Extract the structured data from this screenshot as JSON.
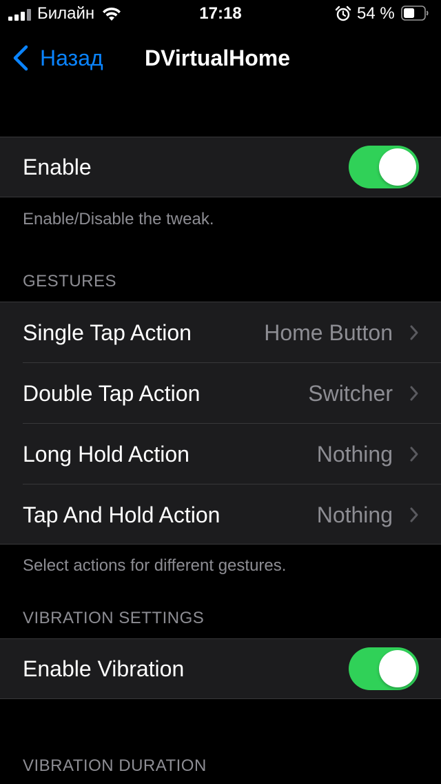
{
  "status_bar": {
    "carrier": "Билайн",
    "time": "17:18",
    "battery_percent": "54 %",
    "battery_level": 0.54,
    "signal_bars_filled": 3,
    "signal_bars_total": 4,
    "icons": [
      "signal-icon",
      "wifi-icon",
      "alarm-icon",
      "battery-icon"
    ]
  },
  "nav": {
    "back_label": "Назад",
    "title": "DVirtualHome",
    "accent_color": "#0a84ff"
  },
  "enable_section": {
    "row_label": "Enable",
    "toggle_on": true,
    "footer": "Enable/Disable the tweak."
  },
  "gestures_section": {
    "header": "GESTURES",
    "rows": [
      {
        "label": "Single Tap Action",
        "value": "Home Button"
      },
      {
        "label": "Double Tap Action",
        "value": "Switcher"
      },
      {
        "label": "Long Hold Action",
        "value": "Nothing"
      },
      {
        "label": "Tap And Hold Action",
        "value": "Nothing"
      }
    ],
    "footer": "Select actions for different gestures."
  },
  "vibration_section": {
    "header": "VIBRATION SETTINGS",
    "row_label": "Enable Vibration",
    "toggle_on": true
  },
  "vibration_duration_section": {
    "header": "VIBRATION DURATION"
  },
  "colors": {
    "background": "#000000",
    "cell_background": "#1c1c1e",
    "toggle_on": "#30d158",
    "secondary_text": "#8d8d93"
  }
}
